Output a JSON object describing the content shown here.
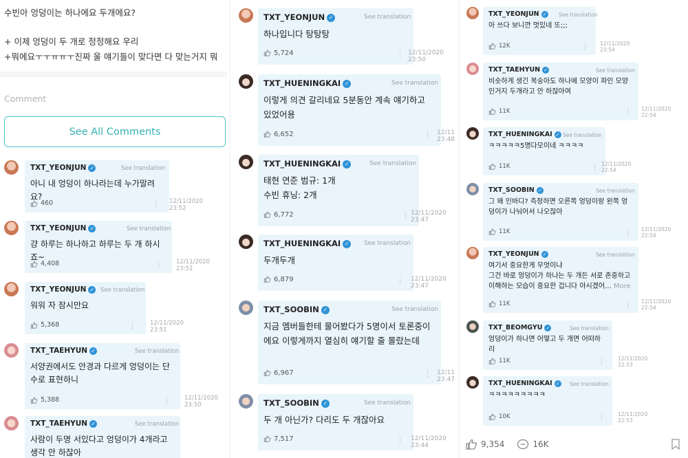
{
  "post": {
    "line1": "수빈아 엉덩이는 하나에요 두개에요?",
    "line2": "+ 이제 엉덩이 두 개로 정정해요 우리",
    "line3": "+뭐에요ㅜㅜㅠㅠㅜ진짜 울 얘기들이 맞다면 다 맞는거지 뭐"
  },
  "comment_label": "Comment",
  "see_all": "See All Comments",
  "see_translation": "See translation",
  "more_label": "More",
  "col1": [
    {
      "user": "TXT_YEONJUN",
      "avatar": "yeonjun",
      "text": "아니 내 엉덩이 하나라는데 누가말려요?",
      "likes": "460",
      "date": "12/11/2020",
      "time": "23:52"
    },
    {
      "user": "TXT_YEONJUN",
      "avatar": "yeonjun",
      "text": "걍 하루는 하나하고 하루는 두 개 하시죠~",
      "likes": "4,408",
      "date": "12/11/2020",
      "time": "23:51"
    },
    {
      "user": "TXT_YEONJUN",
      "avatar": "yeonjun",
      "text": "워워 자 잠시만요",
      "likes": "5,368",
      "date": "12/11/2020",
      "time": "23:51"
    },
    {
      "user": "TXT_TAEHYUN",
      "avatar": "taehyun",
      "text": "서양권에서도 안경과 다르게 엉덩이는 단수로 표현하니",
      "likes": "5,388",
      "date": "12/11/2020",
      "time": "23:50"
    },
    {
      "user": "TXT_TAEHYUN",
      "avatar": "taehyun",
      "text": "사람이 두명 서있다고 엉덩이가 4개라고 생각 안 하잖아",
      "likes": "",
      "date": "",
      "time": ""
    }
  ],
  "col2": [
    {
      "user": "TXT_YEONJUN",
      "avatar": "yeonjun",
      "text": "하나입니다 탕탕탕",
      "likes": "5,724",
      "date": "12/11/2020",
      "time": "23:50"
    },
    {
      "user": "TXT_HUENINGKAI",
      "avatar": "hueningkai",
      "text": "이렇게 의견 갈리네요 5분동안 계속 얘기하고 있었어용",
      "likes": "6,652",
      "date": "12/11",
      "time": "23:48"
    },
    {
      "user": "TXT_HUENINGKAI",
      "avatar": "hueningkai",
      "text": "태현 연준 범규: 1개\n수빈 휴닝: 2개",
      "likes": "6,772",
      "date": "12/11/2020",
      "time": "23:47"
    },
    {
      "user": "TXT_HUENINGKAI",
      "avatar": "hueningkai",
      "text": "두개두개",
      "likes": "6,879",
      "date": "12/11/2020",
      "time": "23:47"
    },
    {
      "user": "TXT_SOOBIN",
      "avatar": "soobin",
      "text": "지금 멤버들한테 물어봤다가 5명이서 토론중이에요 이렇게까지 열심히 얘기할 줄 몰랐는데",
      "likes": "6,967",
      "date": "12/11",
      "time": "23:47"
    },
    {
      "user": "TXT_SOOBIN",
      "avatar": "soobin",
      "text": "두 개 아닌가? 다리도 두 개잖아요",
      "likes": "7,517",
      "date": "12/11/2020",
      "time": "23:44"
    }
  ],
  "col3": [
    {
      "user": "TXT_YEONJUN",
      "avatar": "yeonjun",
      "text": "아 쓰다 보니깐 멋있네 또;;;",
      "likes": "12K",
      "date": "12/11/2020",
      "time": "23:54"
    },
    {
      "user": "TXT_TAEHYUN",
      "avatar": "taehyun",
      "text": "비슷하게 생긴 복숭아도 하나에 모양이 파인 모양인거지 두개라고 안 하잖아여",
      "likes": "11K",
      "date": "12/11/2020",
      "time": "22:54"
    },
    {
      "user": "TXT_HUENINGKAI",
      "avatar": "hueningkai",
      "text": "ㅋㅋㅋㅋㅋ5명다모이네 ㅋㅋㅋㅋ",
      "likes": "11K",
      "date": "12/11/2020",
      "time": "22:54"
    },
    {
      "user": "TXT_SOOBIN",
      "avatar": "soobin",
      "text": "그 왜 인바디? 측정하면 오른쪽 엉덩이랑 왼쪽 엉덩이가 나눠어서 나오잖아",
      "likes": "11K",
      "date": "12/11/2020",
      "time": "22:54"
    },
    {
      "user": "TXT_YEONJUN",
      "avatar": "yeonjun",
      "text": "여기서 중요한게 무엇이냐\n그건 바로 엉덩이가 하나는 두 개든 서로 존중하고 이해하는 모습이 중요한 겁니다 아시겠어...",
      "likes": "11K",
      "date": "12/11/2020",
      "time": "22:54",
      "more": true
    },
    {
      "user": "TXT_BEOMGYU",
      "avatar": "beomgyu",
      "text": "엉덩이가 하나면 어떻고 두 개면 어떠하리",
      "likes": "11K",
      "date": "12/11/2020",
      "time": "22:53"
    },
    {
      "user": "TXT_HUENINGKAI",
      "avatar": "hueningkai",
      "text": "ㅋㅋㅋㅋㅋㅋㅋㅋㅋ",
      "likes": "10K",
      "date": "12/11/2020",
      "time": "22:53"
    }
  ],
  "bottom": {
    "likes": "9,354",
    "comments": "16K"
  },
  "colors": {
    "accent": "#4dc4c6",
    "bubble": "#e9f5fb",
    "verified": "#2f93d6"
  }
}
